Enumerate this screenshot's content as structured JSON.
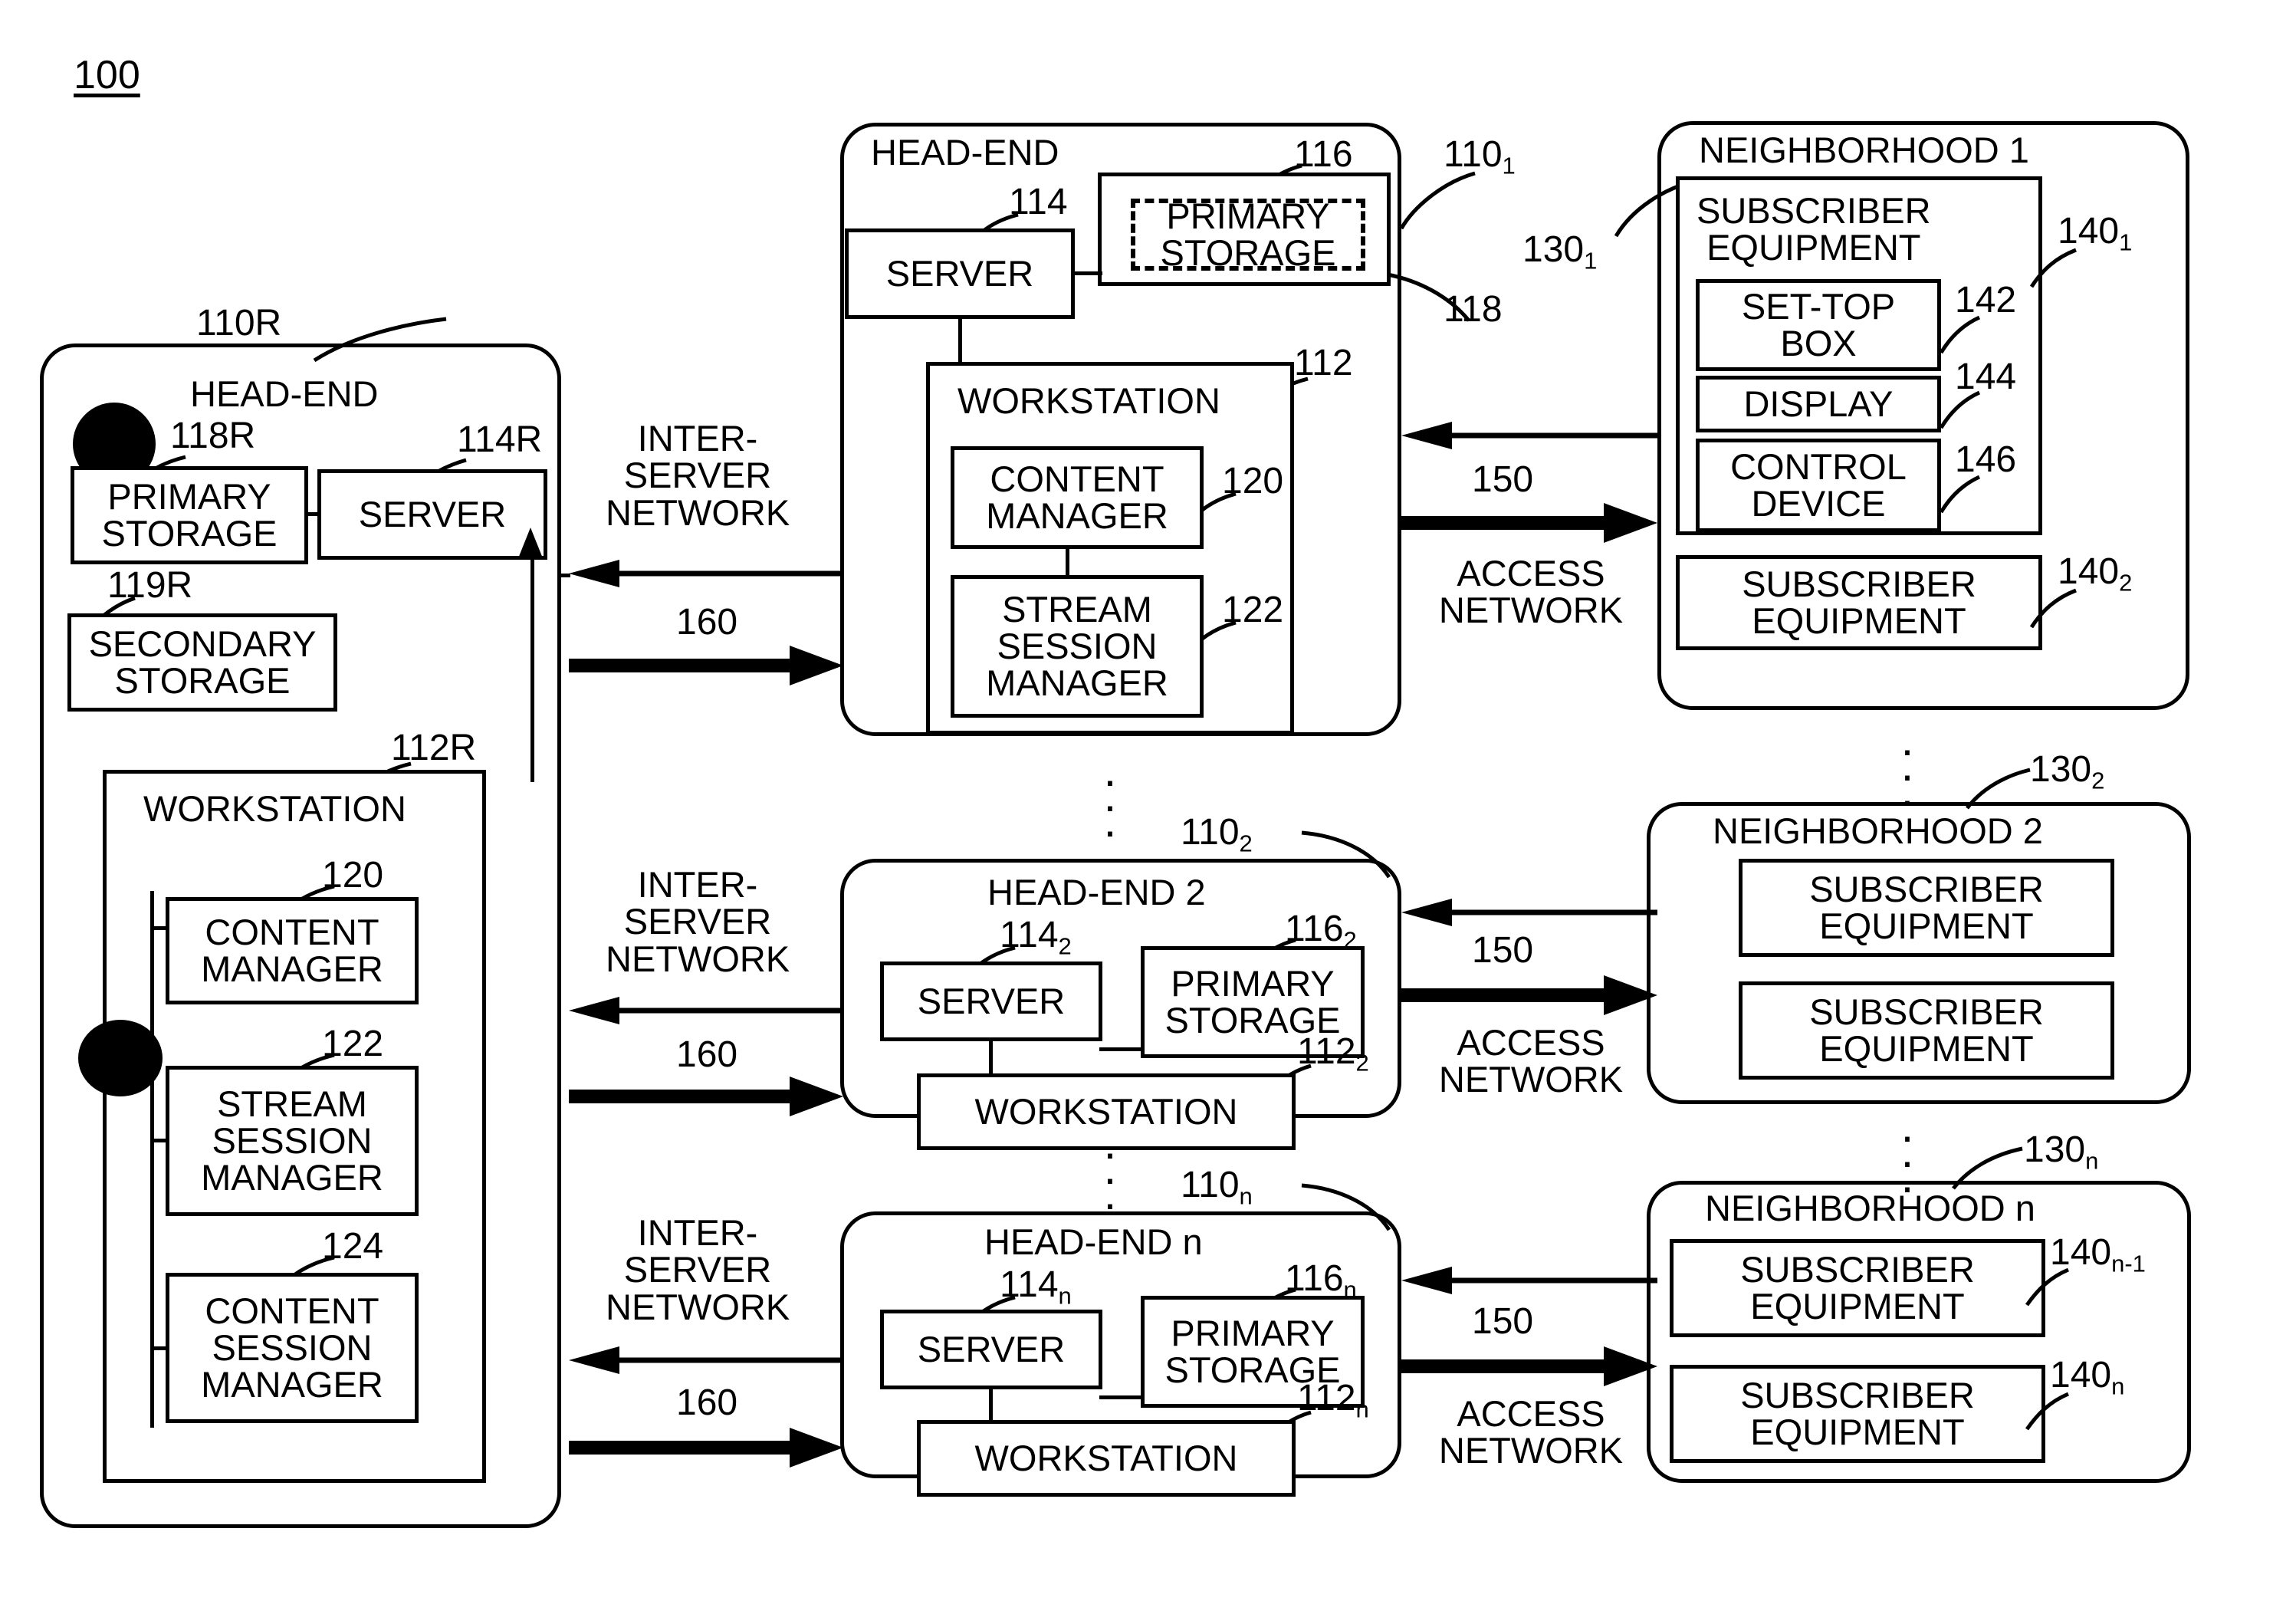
{
  "figure": {
    "number": "100"
  },
  "left_headend": {
    "title": "HEAD-END",
    "ref": "110R",
    "primary_storage": {
      "label": "PRIMARY\nSTORAGE",
      "ref": "118R"
    },
    "secondary_storage": {
      "label": "SECONDARY\nSTORAGE",
      "ref": "119R"
    },
    "server": {
      "label": "SERVER",
      "ref": "114R"
    },
    "workstation": {
      "label": "WORKSTATION",
      "ref": "112R",
      "modules": [
        {
          "label": "CONTENT\nMANAGER",
          "ref": "120"
        },
        {
          "label": "STREAM\nSESSION\nMANAGER",
          "ref": "122"
        },
        {
          "label": "CONTENT\nSESSION\nMANAGER",
          "ref": "124"
        }
      ]
    }
  },
  "headends": [
    {
      "title": "HEAD-END",
      "ref_base": "110",
      "ref_sub": "1",
      "server": {
        "label": "SERVER",
        "ref_base": "114",
        "ref_sub": ""
      },
      "primary_storage": {
        "label": "PRIMARY\nSTORAGE",
        "ref_base": "116",
        "ref_sub": ""
      },
      "storage_link_ref": "118",
      "workstation": {
        "label": "WORKSTATION",
        "ref_base": "112",
        "ref_sub": "",
        "modules": [
          {
            "label": "CONTENT\nMANAGER",
            "ref": "120"
          },
          {
            "label": "STREAM\nSESSION\nMANAGER",
            "ref": "122"
          }
        ]
      }
    },
    {
      "title": "HEAD-END 2",
      "ref_base": "110",
      "ref_sub": "2",
      "server": {
        "label": "SERVER",
        "ref_base": "114",
        "ref_sub": "2"
      },
      "primary_storage": {
        "label": "PRIMARY\nSTORAGE",
        "ref_base": "116",
        "ref_sub": "2"
      },
      "workstation": {
        "label": "WORKSTATION",
        "ref_base": "112",
        "ref_sub": "2"
      }
    },
    {
      "title": "HEAD-END n",
      "ref_base": "110",
      "ref_sub": "n",
      "server": {
        "label": "SERVER",
        "ref_base": "114",
        "ref_sub": "n"
      },
      "primary_storage": {
        "label": "PRIMARY\nSTORAGE",
        "ref_base": "116",
        "ref_sub": "n"
      },
      "workstation": {
        "label": "WORKSTATION",
        "ref_base": "112",
        "ref_sub": "n"
      }
    }
  ],
  "neighborhoods": [
    {
      "title": "NEIGHBORHOOD 1",
      "ref_base": "130",
      "ref_sub": "1",
      "subscriber_equipment": [
        {
          "label": "SUBSCRIBER\nEQUIPMENT",
          "ref_base": "140",
          "ref_sub": "1",
          "devices": [
            {
              "label": "SET-TOP\nBOX",
              "ref": "142"
            },
            {
              "label": "DISPLAY",
              "ref": "144"
            },
            {
              "label": "CONTROL\nDEVICE",
              "ref": "146"
            }
          ]
        },
        {
          "label": "SUBSCRIBER\nEQUIPMENT",
          "ref_base": "140",
          "ref_sub": "2",
          "devices": []
        }
      ]
    },
    {
      "title": "NEIGHBORHOOD 2",
      "ref_base": "130",
      "ref_sub": "2",
      "subscriber_equipment": [
        {
          "label": "SUBSCRIBER\nEQUIPMENT",
          "ref_base": "",
          "ref_sub": "",
          "devices": []
        },
        {
          "label": "SUBSCRIBER\nEQUIPMENT",
          "ref_base": "",
          "ref_sub": "",
          "devices": []
        }
      ]
    },
    {
      "title": "NEIGHBORHOOD n",
      "ref_base": "130",
      "ref_sub": "n",
      "subscriber_equipment": [
        {
          "label": "SUBSCRIBER\nEQUIPMENT",
          "ref_base": "140",
          "ref_sub": "n-1",
          "devices": []
        },
        {
          "label": "SUBSCRIBER\nEQUIPMENT",
          "ref_base": "140",
          "ref_sub": "n",
          "devices": []
        }
      ]
    }
  ],
  "networks": {
    "inter_server": {
      "label": "INTER-\nSERVER\nNETWORK",
      "ref": "160"
    },
    "access": {
      "label": "ACCESS\nNETWORK",
      "ref": "150"
    }
  },
  "colors": {
    "ink": "#000000",
    "paper": "#ffffff"
  }
}
